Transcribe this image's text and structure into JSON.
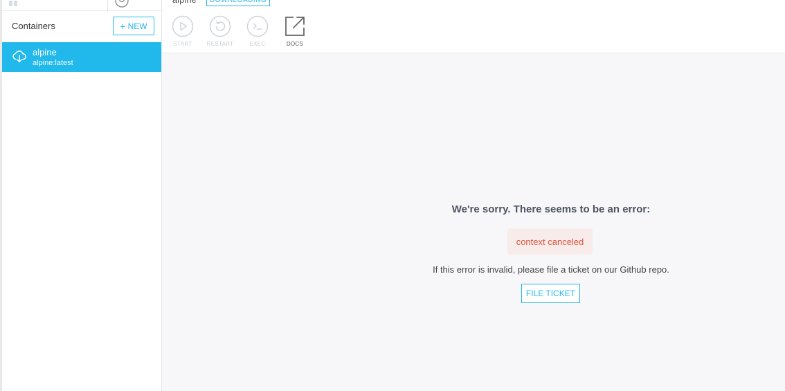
{
  "sidebar": {
    "title": "Containers",
    "new_button": {
      "icon": "plus-icon",
      "label": "NEW"
    },
    "containers": [
      {
        "name": "alpine",
        "image": "alpine:latest",
        "icon": "cloud-download-icon"
      }
    ]
  },
  "header": {
    "container_name": "alpine",
    "state": "DOWNLOADING",
    "actions": [
      {
        "label": "START",
        "icon": "play-icon",
        "enabled": false
      },
      {
        "label": "RESTART",
        "icon": "restart-icon",
        "enabled": false
      },
      {
        "label": "EXEC",
        "icon": "terminal-icon",
        "enabled": false
      },
      {
        "label": "DOCS",
        "icon": "external-link-icon",
        "enabled": true
      }
    ]
  },
  "error": {
    "title": "We're sorry. There seems to be an error:",
    "message": "context canceled",
    "help": "If this error is invalid, please file a ticket on our Github repo.",
    "button_label": "FILE TICKET"
  },
  "colors": {
    "accent": "#21b8eb",
    "error_text": "#e0533c",
    "error_bg": "#f8eceb",
    "main_bg": "#f7f7fa"
  }
}
